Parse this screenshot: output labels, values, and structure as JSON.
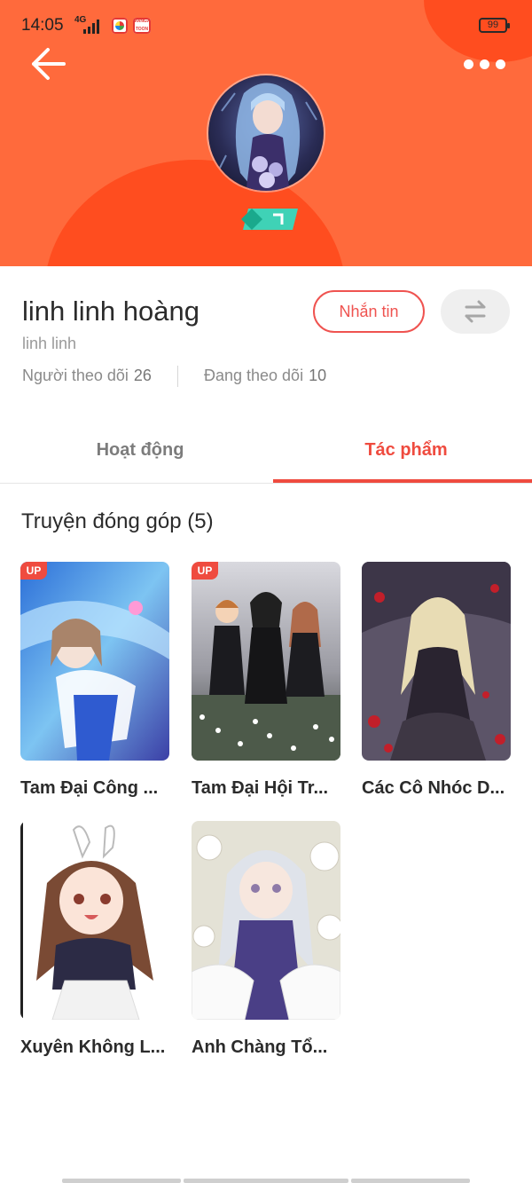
{
  "status_bar": {
    "time": "14:05",
    "network": "4G",
    "battery": "99"
  },
  "profile": {
    "name": "linh linh hoàng",
    "handle": "linh linh",
    "followers_label": "Người theo dõi",
    "followers_count": "26",
    "following_label": "Đang theo dõi",
    "following_count": "10",
    "message_button": "Nhắn tin"
  },
  "tabs": [
    {
      "label": "Hoạt động",
      "active": false
    },
    {
      "label": "Tác phẩm",
      "active": true
    }
  ],
  "section": {
    "title": "Truyện đóng góp (5)"
  },
  "comics": [
    {
      "title": "Tam Đại Công ...",
      "badge": "UP"
    },
    {
      "title": "Tam Đại Hội Tr...",
      "badge": "UP"
    },
    {
      "title": "Các Cô Nhóc D..."
    },
    {
      "title": "Xuyên Không L..."
    },
    {
      "title": "Anh Chàng Tổ..."
    }
  ],
  "colors": {
    "header": "#ff6a3c",
    "header_accent": "#ff4d1f",
    "accent": "#ef4b3f"
  }
}
